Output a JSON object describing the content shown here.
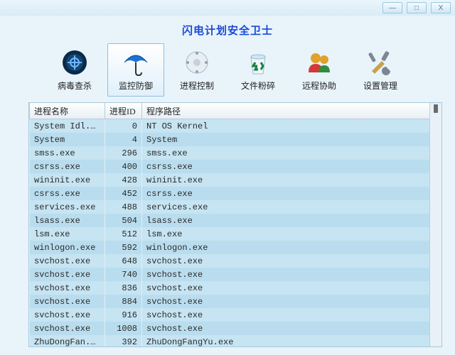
{
  "app_title": "闪电计划安全卫士",
  "window_controls": {
    "min": "—",
    "max": "□",
    "close": "X"
  },
  "toolbar": [
    {
      "id": "virus-scan",
      "label": "病毒查杀",
      "icon": "shield-target-icon",
      "active": false
    },
    {
      "id": "monitor",
      "label": "监控防御",
      "icon": "umbrella-icon",
      "active": true
    },
    {
      "id": "process-ctrl",
      "label": "进程控制",
      "icon": "gear-disc-icon",
      "active": false
    },
    {
      "id": "file-shred",
      "label": "文件粉碎",
      "icon": "recycle-bin-icon",
      "active": false
    },
    {
      "id": "remote-help",
      "label": "远程协助",
      "icon": "people-icon",
      "active": false
    },
    {
      "id": "settings",
      "label": "设置管理",
      "icon": "tools-icon",
      "active": false
    }
  ],
  "columns": {
    "name": "进程名称",
    "pid": "进程ID",
    "path": "程序路径"
  },
  "rows": [
    {
      "name": "System Idl...",
      "pid": 0,
      "path": "NT OS Kernel"
    },
    {
      "name": "System",
      "pid": 4,
      "path": "System"
    },
    {
      "name": "smss.exe",
      "pid": 296,
      "path": "smss.exe"
    },
    {
      "name": "csrss.exe",
      "pid": 400,
      "path": "csrss.exe"
    },
    {
      "name": "wininit.exe",
      "pid": 428,
      "path": "wininit.exe"
    },
    {
      "name": "csrss.exe",
      "pid": 452,
      "path": "csrss.exe"
    },
    {
      "name": "services.exe",
      "pid": 488,
      "path": "services.exe"
    },
    {
      "name": "lsass.exe",
      "pid": 504,
      "path": "lsass.exe"
    },
    {
      "name": "lsm.exe",
      "pid": 512,
      "path": "lsm.exe"
    },
    {
      "name": "winlogon.exe",
      "pid": 592,
      "path": "winlogon.exe"
    },
    {
      "name": "svchost.exe",
      "pid": 648,
      "path": "svchost.exe"
    },
    {
      "name": "svchost.exe",
      "pid": 740,
      "path": "svchost.exe"
    },
    {
      "name": "svchost.exe",
      "pid": 836,
      "path": "svchost.exe"
    },
    {
      "name": "svchost.exe",
      "pid": 884,
      "path": "svchost.exe"
    },
    {
      "name": "svchost.exe",
      "pid": 916,
      "path": "svchost.exe"
    },
    {
      "name": "svchost.exe",
      "pid": 1008,
      "path": "svchost.exe"
    },
    {
      "name": "ZhuDongFan...",
      "pid": 392,
      "path": "ZhuDongFangYu.exe"
    }
  ]
}
